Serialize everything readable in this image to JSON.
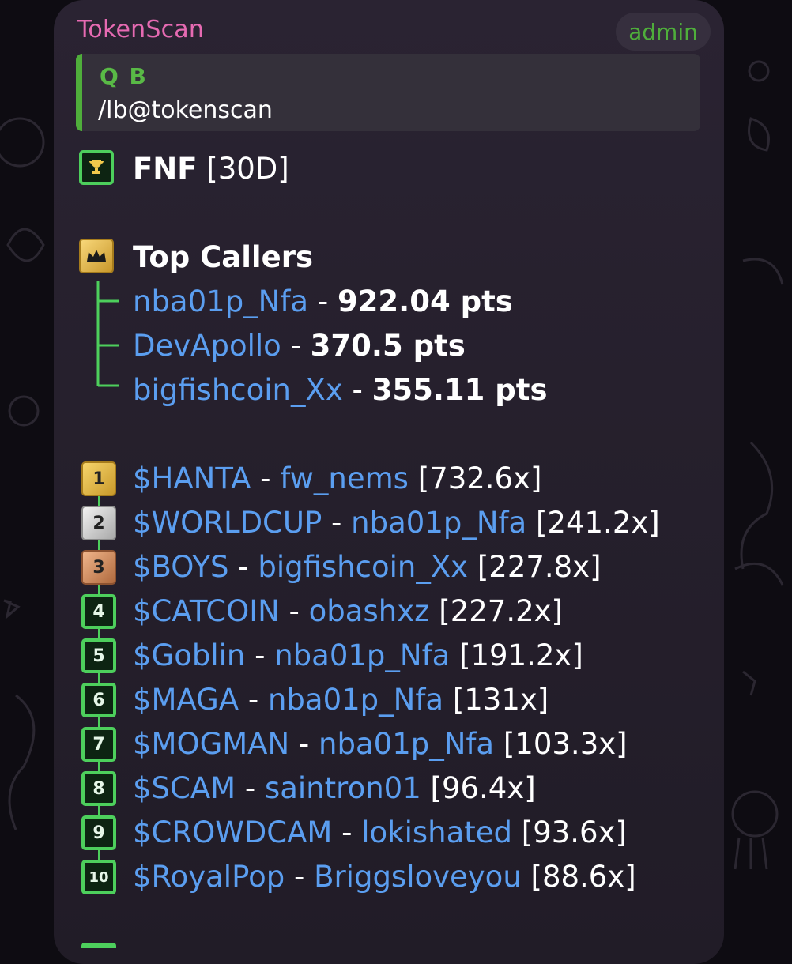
{
  "message": {
    "sender": "TokenScan",
    "badge": "admin",
    "reply": {
      "name": "Q B",
      "text": "/lb@tokenscan"
    },
    "header": {
      "title": "FNF",
      "period": "[30D]"
    },
    "top_callers": {
      "title": "Top Callers",
      "items": [
        {
          "name": "nba01p_Nfa",
          "sep": " - ",
          "score": "922.04 pts"
        },
        {
          "name": "DevApollo",
          "sep": " - ",
          "score": "370.5 pts"
        },
        {
          "name": "bigfishcoin_Xx",
          "sep": " - ",
          "score": "355.11 pts"
        }
      ]
    },
    "leaderboard": [
      {
        "rank": "1",
        "token": "$HANTA",
        "sep": " - ",
        "caller": "fw_nems",
        "multiple": "[732.6x]",
        "medal": "gold"
      },
      {
        "rank": "2",
        "token": "$WORLDCUP",
        "sep": " - ",
        "caller": "nba01p_Nfa",
        "multiple": "[241.2x]",
        "medal": "silver"
      },
      {
        "rank": "3",
        "token": "$BOYS",
        "sep": " - ",
        "caller": "bigfishcoin_Xx",
        "multiple": "[227.8x]",
        "medal": "bronze"
      },
      {
        "rank": "4",
        "token": "$CATCOIN",
        "sep": " - ",
        "caller": "obashxz",
        "multiple": "[227.2x]",
        "medal": "green"
      },
      {
        "rank": "5",
        "token": "$Goblin",
        "sep": " - ",
        "caller": "nba01p_Nfa",
        "multiple": "[191.2x]",
        "medal": "green"
      },
      {
        "rank": "6",
        "token": "$MAGA",
        "sep": " - ",
        "caller": "nba01p_Nfa",
        "multiple": "[131x]",
        "medal": "green"
      },
      {
        "rank": "7",
        "token": "$MOGMAN",
        "sep": " - ",
        "caller": "nba01p_Nfa",
        "multiple": "[103.3x]",
        "medal": "green"
      },
      {
        "rank": "8",
        "token": "$SCAM",
        "sep": " - ",
        "caller": "saintron01",
        "multiple": "[96.4x]",
        "medal": "green"
      },
      {
        "rank": "9",
        "token": "$CROWDCAM",
        "sep": " - ",
        "caller": "lokishated",
        "multiple": "[93.6x]",
        "medal": "green"
      },
      {
        "rank": "10",
        "token": "$RoyalPop",
        "sep": " - ",
        "caller": "Briggsloveyou",
        "multiple": "[88.6x]",
        "medal": "green"
      }
    ]
  },
  "colors": {
    "sender": "#e66ab2",
    "admin": "#4fae3b",
    "link": "#5b9ef0",
    "reply_accent": "#4fae3b",
    "rank_border": "#4dcf5c"
  }
}
